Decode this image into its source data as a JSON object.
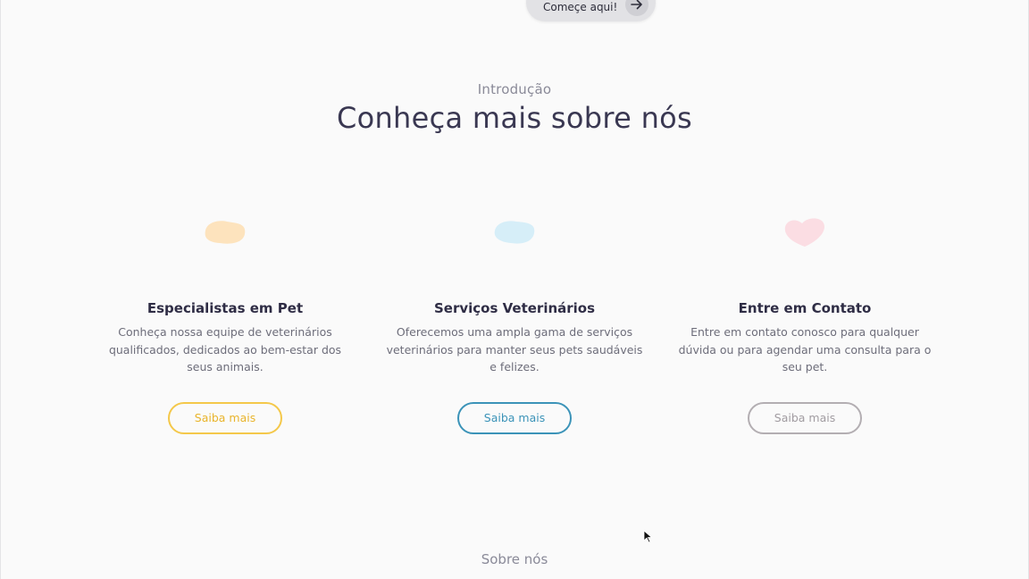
{
  "hero": {
    "cta_label": "Começe aqui!",
    "cta_icon": "arrow-right-icon"
  },
  "intro": {
    "eyebrow": "Introdução",
    "title": "Conheça mais sobre nós"
  },
  "cards": [
    {
      "title": "Especialistas em Pet",
      "description": "Conheça nossa equipe de veterinários qualificados, dedicados ao bem-estar dos seus animais.",
      "button_label": "Saiba mais",
      "accent": "#f4c84a",
      "blob_color": "#fde3bd"
    },
    {
      "title": "Serviços Veterinários",
      "description": "Oferecemos uma ampla gama de serviços veterinários para manter seus pets saudáveis e felizes.",
      "button_label": "Saiba mais",
      "accent": "#3b93b8",
      "blob_color": "#d6eef8"
    },
    {
      "title": "Entre em Contato",
      "description": "Entre em contato conosco para qualquer dúvida ou para agendar uma consulta para o seu pet.",
      "button_label": "Saiba mais",
      "accent": "#b3aeb2",
      "blob_color": "#fbdde3"
    }
  ],
  "about": {
    "eyebrow": "Sobre nós"
  }
}
